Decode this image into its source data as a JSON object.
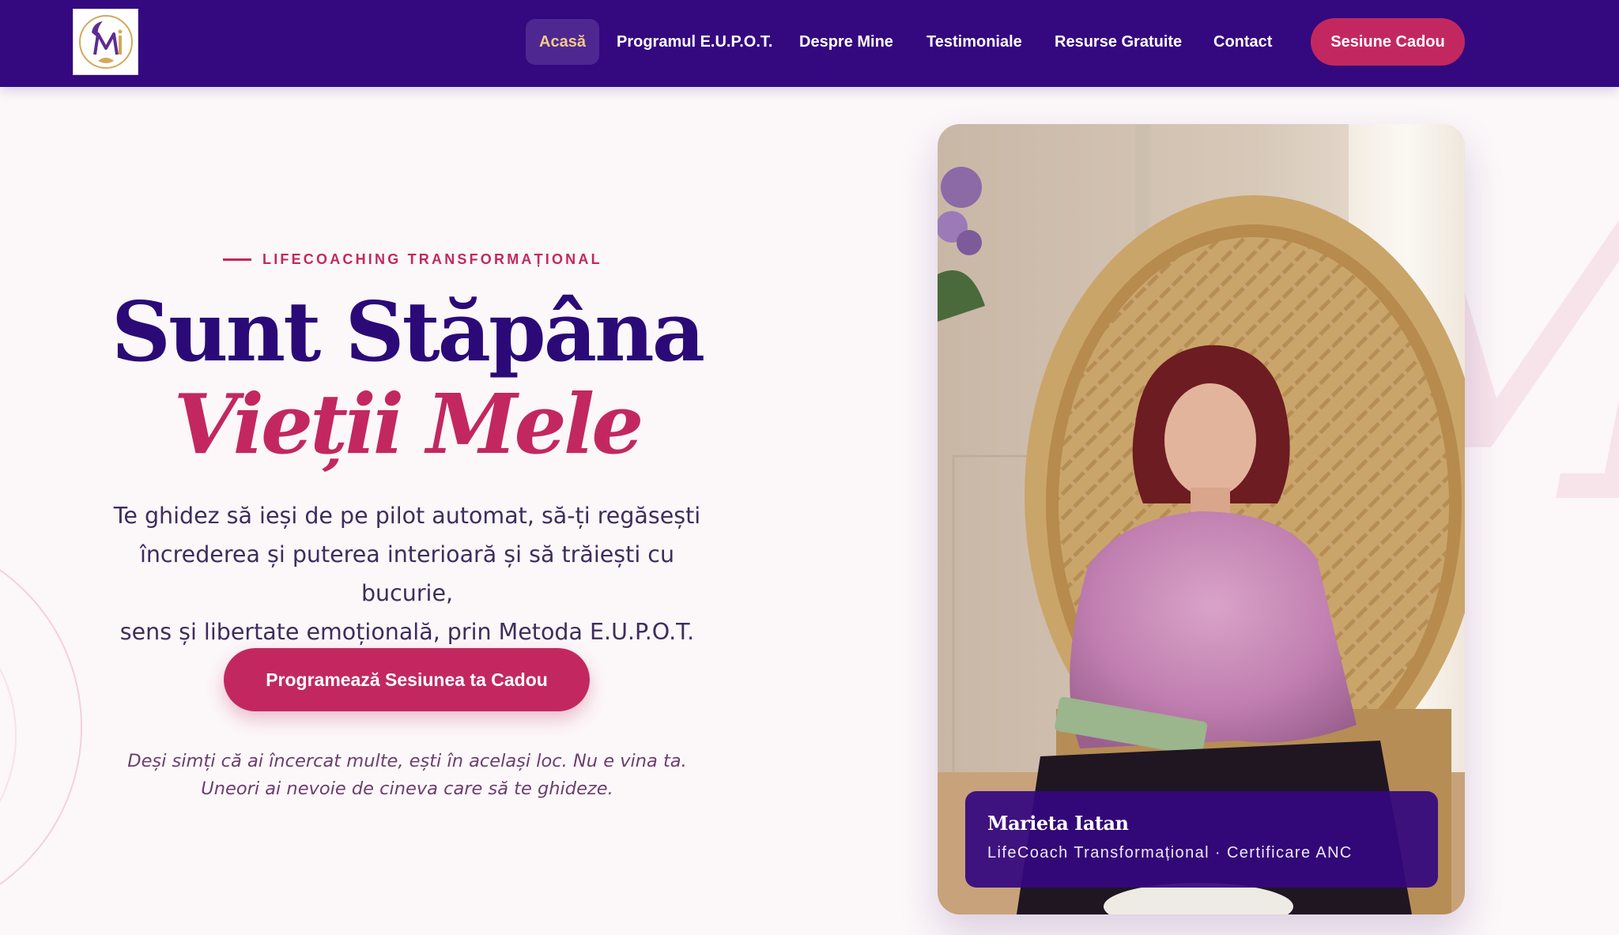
{
  "nav": {
    "logo_text": "MI",
    "items": [
      {
        "label": "Acasă",
        "active": true
      },
      {
        "label": "Programul E.U.P.O.T."
      },
      {
        "label": "Despre Mine"
      },
      {
        "label": "Testimoniale"
      },
      {
        "label": "Resurse Gratuite"
      },
      {
        "label": "Contact"
      }
    ],
    "cta_label": "Sesiune Cadou"
  },
  "hero": {
    "eyebrow": "LIFECOACHING TRANSFORMAȚIONAL",
    "title_line1": "Sunt Stăpâna",
    "title_line2": "Vieții Mele",
    "lead_lines": [
      "Te ghidez să ieși de pe pilot automat, să-ți regăsești",
      "încrederea și puterea interioară și să trăiești cu bucurie,",
      "sens și libertate emoțională, prin Metoda E.U.P.O.T."
    ],
    "button_label": "Programează Sesiunea ta Cadou",
    "note_lines": [
      "Deși simți că ai încercat multe, ești în același loc. Nu e vina ta.",
      "Uneori ai nevoie de cineva care să te ghideze."
    ]
  },
  "profile": {
    "name": "Marieta Iatan",
    "role": "LifeCoach Transformațional · Certificare ANC"
  },
  "colors": {
    "primary": "#34087f",
    "accent": "#c2285f",
    "active_nav_text": "#f4c98a",
    "background": "#fcf7f9"
  }
}
